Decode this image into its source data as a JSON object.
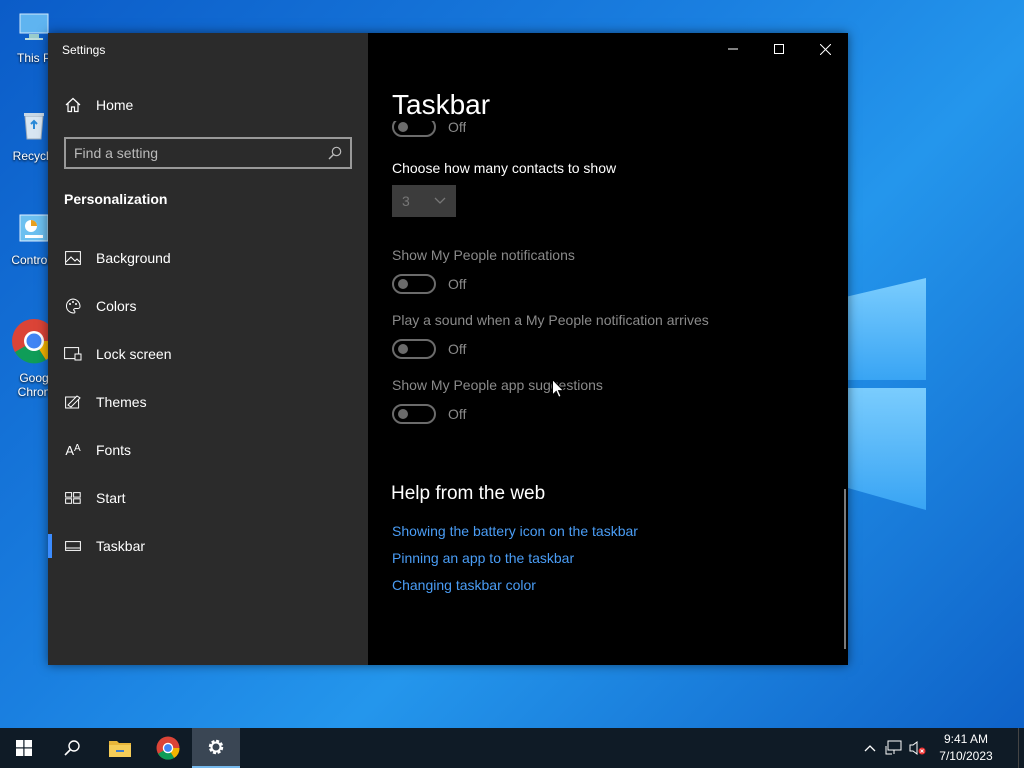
{
  "desktop": {
    "icons": [
      {
        "label": "This P"
      },
      {
        "label": "Recycle"
      },
      {
        "label": "Control I"
      },
      {
        "label": "Goog\nChron"
      }
    ]
  },
  "window": {
    "title": "Settings",
    "minimize": "–",
    "maximize": "□",
    "close": "✕"
  },
  "sidebar": {
    "home_label": "Home",
    "search_placeholder": "Find a setting",
    "section_title": "Personalization",
    "items": [
      {
        "label": "Background",
        "icon": "image-icon"
      },
      {
        "label": "Colors",
        "icon": "palette-icon"
      },
      {
        "label": "Lock screen",
        "icon": "lock-screen-icon"
      },
      {
        "label": "Themes",
        "icon": "themes-icon"
      },
      {
        "label": "Fonts",
        "icon": "fonts-icon"
      },
      {
        "label": "Start",
        "icon": "start-icon"
      },
      {
        "label": "Taskbar",
        "icon": "taskbar-icon",
        "active": true
      }
    ]
  },
  "content": {
    "page_title": "Taskbar",
    "top_toggle_state": "Off",
    "contacts_label": "Choose how many contacts to show",
    "contacts_value": "3",
    "settings": [
      {
        "label": "Show My People notifications",
        "state": "Off"
      },
      {
        "label": "Play a sound when a My People notification arrives",
        "state": "Off"
      },
      {
        "label": "Show My People app suggestions",
        "state": "Off"
      }
    ],
    "help_title": "Help from the web",
    "help_links": [
      "Showing the battery icon on the taskbar",
      "Pinning an app to the taskbar",
      "Changing taskbar color"
    ]
  },
  "taskbar": {
    "time": "9:41 AM",
    "date": "7/10/2023"
  },
  "colors": {
    "accent": "#3b8cff",
    "link": "#4a9df5"
  }
}
